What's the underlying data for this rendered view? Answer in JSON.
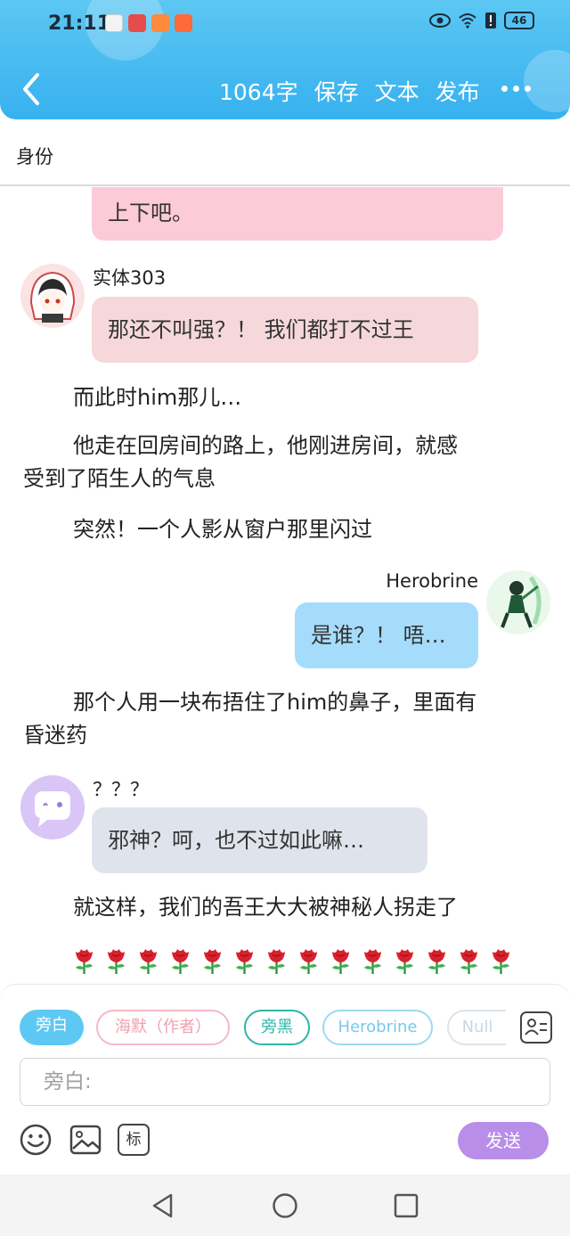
{
  "status_bar": {
    "time": "21:11",
    "battery": "46"
  },
  "toolbar": {
    "word_count": "1064字",
    "save": "保存",
    "text": "文本",
    "publish": "发布"
  },
  "identity": {
    "label": "身份"
  },
  "messages": {
    "m0": {
      "text": "上下吧。"
    },
    "m1": {
      "speaker": "实体303",
      "text": "那还不叫强？！ 我们都打不过王"
    },
    "n1": {
      "text": "而此时him那儿…"
    },
    "n2": {
      "line1": "他走在回房间的路上，他刚进房间，就感",
      "line2": "受到了陌生人的气息"
    },
    "n3": {
      "text": "突然！一个人影从窗户那里闪过"
    },
    "m2": {
      "speaker": "Herobrine",
      "text": "是谁？！ 唔…"
    },
    "n4": {
      "line1": "那个人用一块布捂住了him的鼻子，里面有",
      "line2": "昏迷药"
    },
    "m3": {
      "speaker": "？？？",
      "text": "邪神？呵，也不过如此嘛…"
    },
    "n5": {
      "text": "就这样，我们的吾王大大被神秘人拐走了"
    }
  },
  "roles": [
    "旁白",
    "海默（作者）",
    "旁黑",
    "Herobrine",
    "Null"
  ],
  "input": {
    "placeholder": "旁白:"
  },
  "tools": {
    "tag_label": "标"
  },
  "send_label": "发送",
  "colors": {
    "header": "#37b1ef",
    "pink_bubble": "#fccbd8",
    "rose_bubble": "#f6d8da",
    "blue_bubble": "#a6dcfb",
    "gray_bubble": "#dfe4ec",
    "send": "#b88ee8"
  }
}
